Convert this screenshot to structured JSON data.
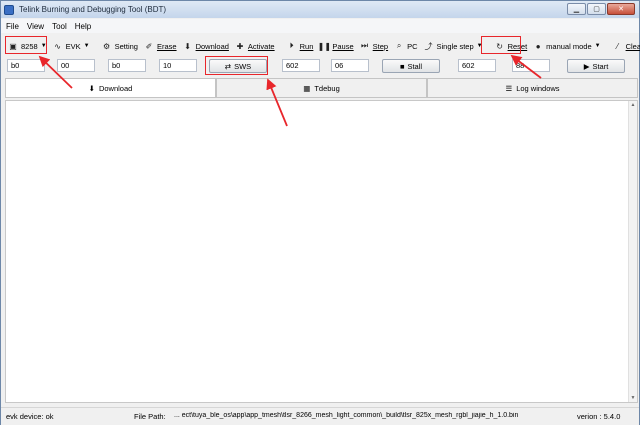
{
  "window": {
    "title": "Telink Burning and Debugging Tool (BDT)",
    "controls": [
      "minimize-icon",
      "maximize-icon",
      "close-icon"
    ]
  },
  "menu": [
    "File",
    "View",
    "Tool",
    "Help"
  ],
  "toolbar": {
    "chip": "8258",
    "board": "EVK",
    "setting": "Setting",
    "erase": "Erase",
    "download": "Download",
    "activate": "Activate",
    "run": "Run",
    "pause": "Pause",
    "step": "Step",
    "pc": "PC",
    "single_step": "Single step",
    "reset": "Reset",
    "mode": "manual mode",
    "clear": "Clear"
  },
  "fields": {
    "f1": "b0",
    "f2": "00",
    "f3": "b0",
    "f4": "10",
    "sws_button": "SWS",
    "f5": "602",
    "f6": "06",
    "stall_button": "Stall",
    "f7": "602",
    "f8": "88",
    "start_button": "Start"
  },
  "tabs": [
    {
      "label": "Download",
      "icon": "download-icon"
    },
    {
      "label": "Tdebug",
      "icon": "grid-icon"
    },
    {
      "label": "Log windows",
      "icon": "list-icon"
    }
  ],
  "status": {
    "device": "evk device: ok",
    "file_path_label": "File Path:",
    "file_path": "... ect\\tuya_ble_os\\app\\app_tmesh\\tlsr_8266_mesh_light_common\\_build\\tlsr_825x_mesh_rgbl_jiajie_h_1.0.bin",
    "version": "verion : 5.4.0"
  },
  "colors": {
    "annotation": "#e8262b"
  }
}
